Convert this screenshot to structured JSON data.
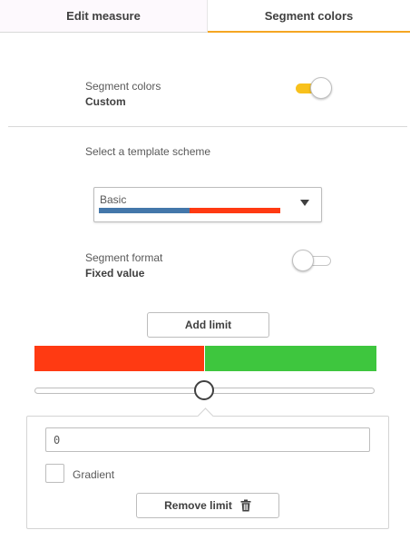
{
  "tabs": {
    "edit_measure": "Edit measure",
    "segment_colors": "Segment colors"
  },
  "segment_colors_setting": {
    "label": "Segment colors",
    "value": "Custom",
    "toggle_on": true
  },
  "template": {
    "label": "Select a template scheme",
    "selected": "Basic",
    "swatch_colors": [
      "#4477aa",
      "#ff3a12"
    ],
    "icon": "chevron-down-icon"
  },
  "segment_format": {
    "label": "Segment format",
    "value": "Fixed value",
    "toggle_on": false
  },
  "add_limit_label": "Add limit",
  "segments": [
    {
      "color": "#ff3a12"
    },
    {
      "color": "#3ec63e"
    }
  ],
  "slider": {
    "value_fraction": 0.5
  },
  "limit_editor": {
    "value": "0",
    "gradient_label": "Gradient",
    "gradient_checked": false,
    "remove_limit_label": "Remove limit",
    "remove_icon": "trash-icon"
  },
  "colors": {
    "accent": "#f5a623",
    "toggle_on": "#f8c11c"
  }
}
